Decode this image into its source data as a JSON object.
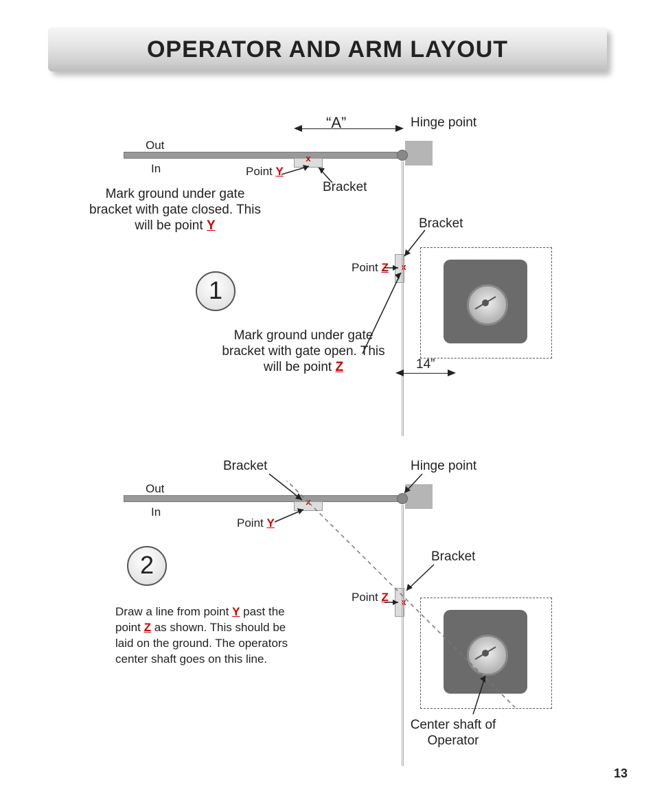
{
  "title": "OPERATOR AND ARM LAYOUT",
  "page_number": "13",
  "step1": {
    "number": "1",
    "out": "Out",
    "in": "In",
    "pointY_label": "Point ",
    "pointY_letter": "Y",
    "pointZ_label": "Point ",
    "pointZ_letter": "Z",
    "dimA": "“A”",
    "hinge": "Hinge point",
    "bracket": "Bracket",
    "dim14": "14”",
    "markY": "Mark ground under gate bracket with gate closed. This will be point ",
    "markZ": "Mark ground under gate bracket with gate open. This will be point "
  },
  "step2": {
    "number": "2",
    "out": "Out",
    "in": "In",
    "pointY_label": "Point ",
    "pointY_letter": "Y",
    "pointZ_label": "Point ",
    "pointZ_letter": "Z",
    "hinge": "Hinge point",
    "bracket": "Bracket",
    "center_shaft": "Center shaft of Operator",
    "note_p1": "Draw a line from point ",
    "note_p2": " past the point ",
    "note_p3": " as shown. This should be laid on the ground. The operators center shaft goes on this line."
  }
}
